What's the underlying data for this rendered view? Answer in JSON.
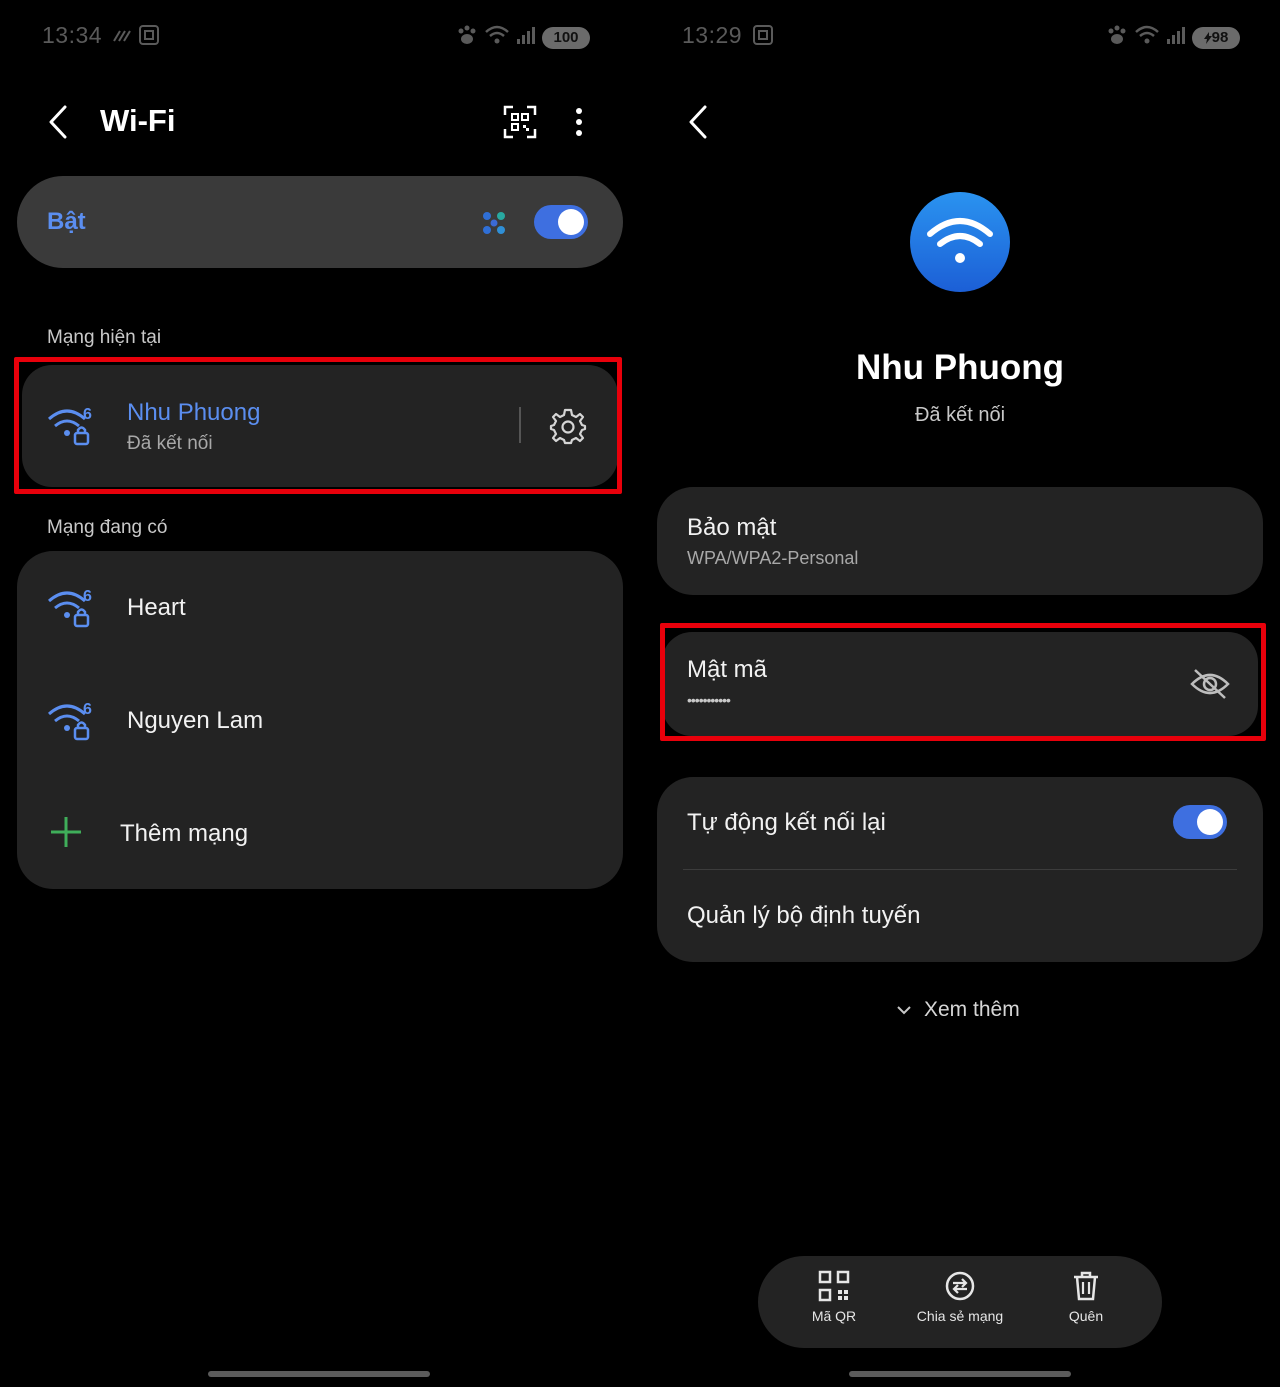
{
  "left": {
    "status": {
      "time": "13:34",
      "battery": "100"
    },
    "header": {
      "title": "Wi-Fi"
    },
    "master_switch": {
      "label": "Bật",
      "on": true
    },
    "current_section": "Mạng hiện tại",
    "current_network": {
      "name": "Nhu Phuong",
      "status": "Đã kết nối"
    },
    "available_section": "Mạng đang có",
    "networks": [
      {
        "name": "Heart"
      },
      {
        "name": "Nguyen Lam"
      }
    ],
    "add_network": "Thêm mạng"
  },
  "right": {
    "status": {
      "time": "13:29",
      "battery": "98"
    },
    "network": {
      "name": "Nhu Phuong",
      "status": "Đã kết nối"
    },
    "security": {
      "label": "Bảo mật",
      "value": "WPA/WPA2-Personal"
    },
    "password": {
      "label": "Mật mã",
      "value": "•••••••••••"
    },
    "auto_reconnect": {
      "label": "Tự động kết nối lại",
      "on": true
    },
    "router_manage": "Quản lý bộ định tuyến",
    "see_more": "Xem thêm",
    "actions": {
      "qr": "Mã QR",
      "share": "Chia sẻ mạng",
      "forget": "Quên"
    }
  },
  "colors": {
    "accent": "#3e6fe0",
    "highlight": "#e8000b",
    "card": "#232323",
    "link": "#5b8ef0"
  }
}
